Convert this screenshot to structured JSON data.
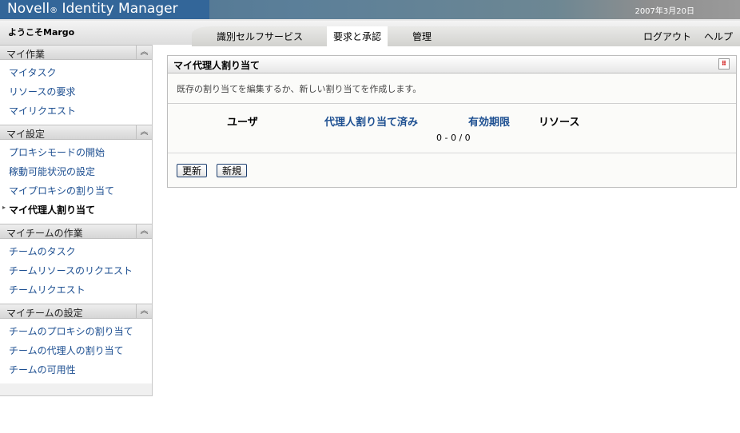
{
  "header": {
    "brand": "Novell",
    "brand_mark": "®",
    "product": "Identity Manager",
    "date": "2007年3月20日",
    "welcome": "ようこそMargo"
  },
  "nav": {
    "tabs": [
      "識別セルフサービス",
      "要求と承認",
      "管理"
    ],
    "active_tab": "要求と承認",
    "logout": "ログアウト",
    "help": "ヘルプ"
  },
  "sidebar": {
    "collapse_icon": "double-chevron-up-icon",
    "sections": [
      {
        "title": "マイ作業",
        "items": [
          "マイタスク",
          "リソースの要求",
          "マイリクエスト"
        ]
      },
      {
        "title": "マイ設定",
        "items": [
          "プロキシモードの開始",
          "稼動可能状況の設定",
          "マイプロキシの割り当て",
          "マイ代理人割り当て"
        ]
      },
      {
        "title": "マイチームの作業",
        "items": [
          "チームのタスク",
          "チームリソースのリクエスト",
          "チームリクエスト"
        ]
      },
      {
        "title": "マイチームの設定",
        "items": [
          "チームのプロキシの割り当て",
          "チームの代理人の割り当て",
          "チームの可用性"
        ]
      }
    ],
    "current": "マイ代理人割り当て"
  },
  "panel": {
    "title": "マイ代理人割り当て",
    "description": "既存の割り当てを編集するか、新しい割り当てを作成します。",
    "columns": [
      "ユーザ",
      "代理人割り当て済み",
      "有効期限",
      "リソース"
    ],
    "count": "0 - 0 / 0",
    "refresh": "更新",
    "new": "新規"
  },
  "colors": {
    "brand": "#336699",
    "link": "#1d4f91"
  }
}
